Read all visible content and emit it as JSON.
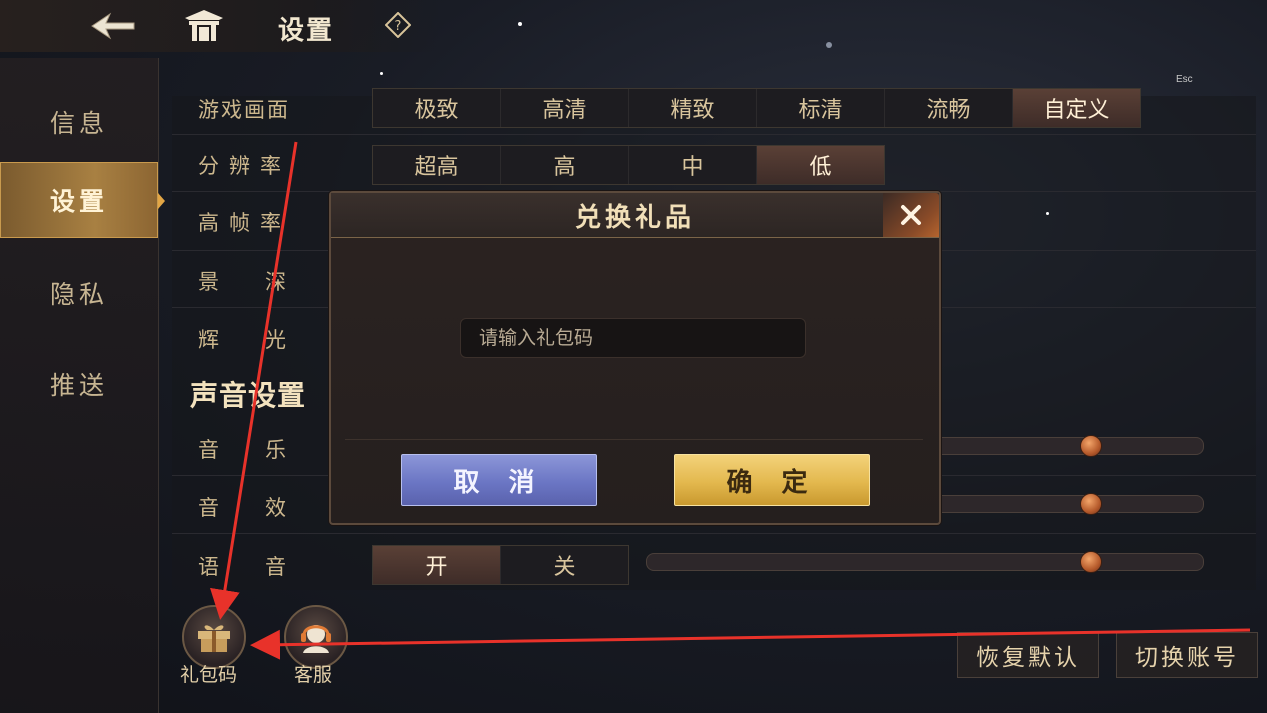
{
  "header": {
    "title": "设置",
    "esc_hint": "Esc"
  },
  "sidebar": {
    "items": [
      {
        "label": "信息"
      },
      {
        "label": "设置"
      },
      {
        "label": "隐私"
      },
      {
        "label": "推送"
      }
    ],
    "active_index": 1
  },
  "settings": {
    "graphics_label": "游戏画面",
    "graphics_options": [
      "极致",
      "高清",
      "精致",
      "标清",
      "流畅",
      "自定义"
    ],
    "graphics_selected": "自定义",
    "resolution_label": "分辨率",
    "resolution_options": [
      "超高",
      "高",
      "中",
      "低"
    ],
    "resolution_selected": "低",
    "high_fps_label": "高帧率",
    "depth_label": "景深",
    "glow_label": "辉光",
    "sound_section_title": "声音设置",
    "music_label": "音乐",
    "music_level": 0.81,
    "sfx_label": "音效",
    "sfx_level": 0.81,
    "voice_label": "语音",
    "voice_options": [
      "开",
      "关"
    ],
    "voice_selected": "开",
    "voice_level": 0.81
  },
  "bottom": {
    "gift_code_label": "礼包码",
    "service_label": "客服",
    "restore_default_label": "恢复默认",
    "switch_account_label": "切换账号"
  },
  "modal": {
    "title": "兑换礼品",
    "input_placeholder": "请输入礼包码",
    "input_value": "",
    "cancel_label": "取 消",
    "confirm_label": "确 定"
  },
  "colors": {
    "accent": "#a88042",
    "annotation": "#e8322a",
    "cancel_button": "#6b76c4",
    "confirm_button": "#e3b84e"
  },
  "icons": [
    "back-arrow-icon",
    "pavilion-home-icon",
    "help-diamond-icon",
    "close-x-icon",
    "gift-box-icon",
    "headset-service-icon"
  ]
}
